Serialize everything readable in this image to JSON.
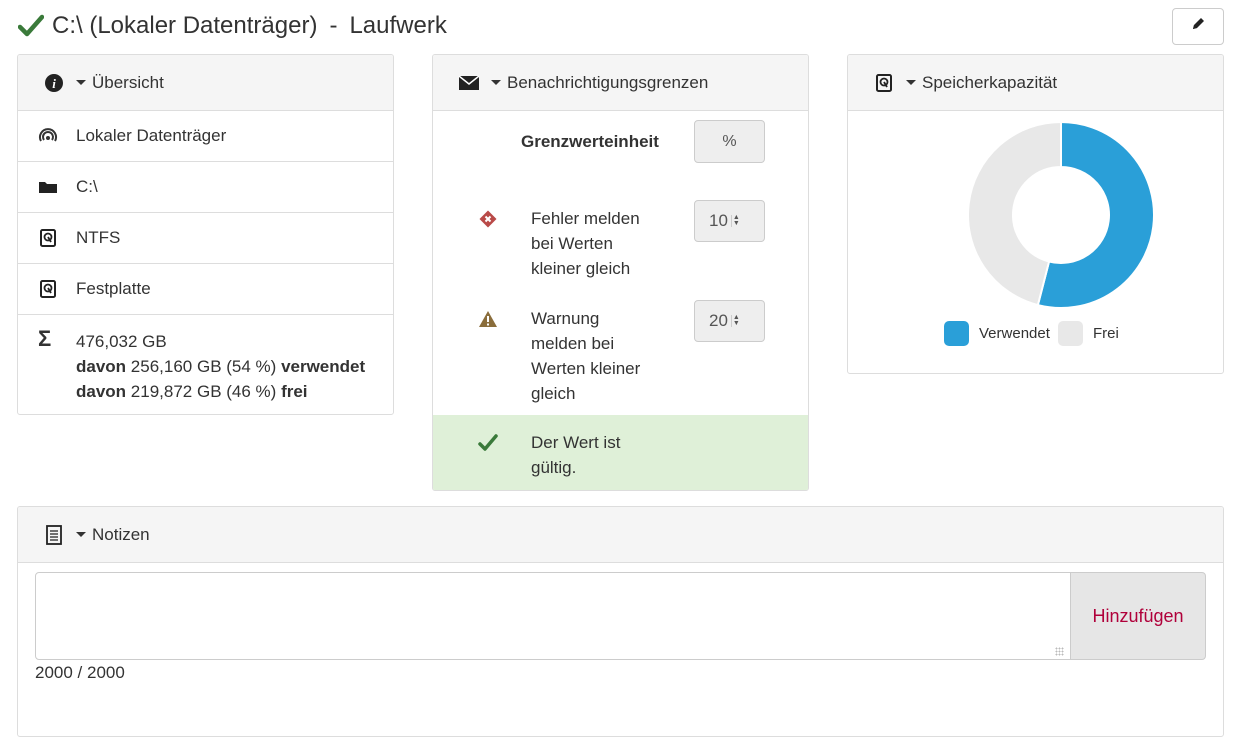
{
  "header": {
    "drive": "C:\\ (Lokaler Datenträger)",
    "separator": "-",
    "type": "Laufwerk"
  },
  "overview": {
    "title": "Übersicht",
    "rows": [
      {
        "icon": "signal-icon",
        "text": "Lokaler Datenträger"
      },
      {
        "icon": "folder-icon",
        "text": "C:\\"
      },
      {
        "icon": "hdd-icon",
        "text": "NTFS"
      },
      {
        "icon": "hdd-icon",
        "text": "Festplatte"
      }
    ],
    "total": "476,032 GB",
    "used_prefix": "davon",
    "used_value": "256,160 GB (54 %)",
    "used_label": "verwendet",
    "free_prefix": "davon",
    "free_value": "219,872 GB (46 %)",
    "free_label": "frei"
  },
  "notifications": {
    "title": "Benachrichtigungsgrenzen",
    "unit_label": "Grenzwerteinheit",
    "unit_value": "%",
    "error_line1": "Fehler melden",
    "error_line2": "bei Werten",
    "error_line3": "kleiner gleich",
    "error_value": "10",
    "warn_line1": "Warnung",
    "warn_line2": "melden bei",
    "warn_line3": "Werten kleiner",
    "warn_line4": "gleich",
    "warn_value": "20",
    "valid_line1": "Der Wert ist",
    "valid_line2": "gültig."
  },
  "capacity": {
    "title": "Speicherkapazität",
    "legend_used": "Verwendet",
    "legend_free": "Frei"
  },
  "chart_data": {
    "type": "pie",
    "categories": [
      "Verwendet",
      "Frei"
    ],
    "values": [
      54,
      46
    ],
    "colors": [
      "#2a9fd8",
      "#e8e8e8"
    ],
    "legend": "bottom"
  },
  "notes": {
    "title": "Notizen",
    "add_label": "Hinzufügen",
    "counter": "2000 / 2000",
    "input_value": ""
  },
  "colors": {
    "success": "#3a7a3a",
    "error": "#b94a48",
    "warning": "#8a6d3b",
    "valid_bg": "#dff0d8",
    "accent": "#b0003a"
  }
}
